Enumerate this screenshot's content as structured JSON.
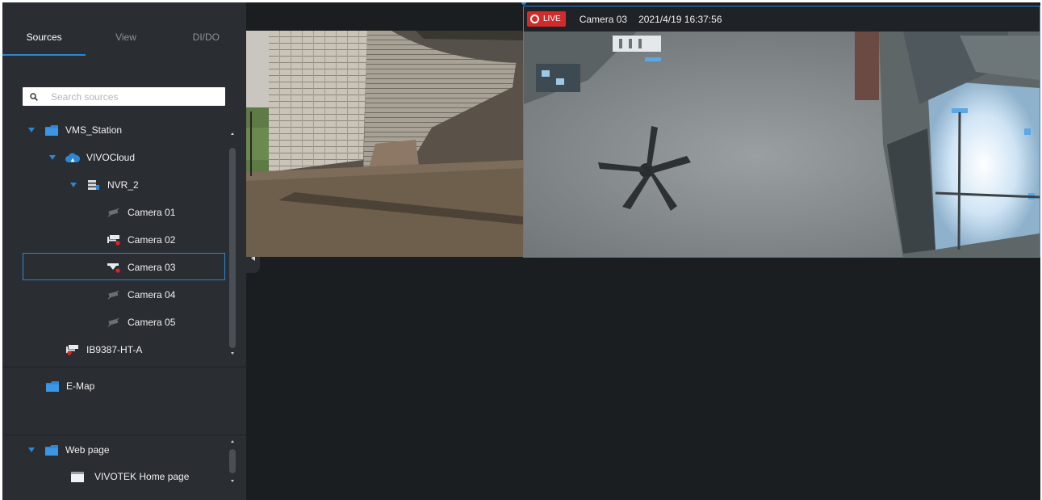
{
  "sidebar": {
    "tabs": [
      {
        "label": "Sources",
        "active": true
      },
      {
        "label": "View",
        "active": false
      },
      {
        "label": "DI/DO",
        "active": false
      }
    ],
    "search": {
      "placeholder": "Search sources",
      "value": ""
    },
    "tree": {
      "station": "VMS_Station",
      "cloud": "VIVOCloud",
      "nvr": "NVR_2",
      "cameras": [
        "Camera 01",
        "Camera 02",
        "Camera 03",
        "Camera 04",
        "Camera 05"
      ],
      "device": "IB9387-HT-A",
      "selected": "Camera 03"
    },
    "emap": {
      "label": "E-Map"
    },
    "webpage": {
      "group": "Web page",
      "item": "VIVOTEK Home page"
    }
  },
  "live_view": {
    "badge": "LIVE",
    "camera": "Camera 03",
    "timestamp": "2021/4/19 16:37:56"
  },
  "colors": {
    "accent": "#2d86d3",
    "live": "#d12b2b",
    "panel": "#2a2e33",
    "background": "#1b1e21",
    "offline_icon": "#6b6f74",
    "alert_dot": "#e02424"
  },
  "icons": [
    "search-icon",
    "folder-icon",
    "cloud-icon",
    "nvr-icon",
    "camera-icon",
    "camera-offline-icon",
    "dome-camera-icon",
    "webpage-icon",
    "caret-down-icon",
    "collapse-arrow-icon",
    "live-icon"
  ]
}
